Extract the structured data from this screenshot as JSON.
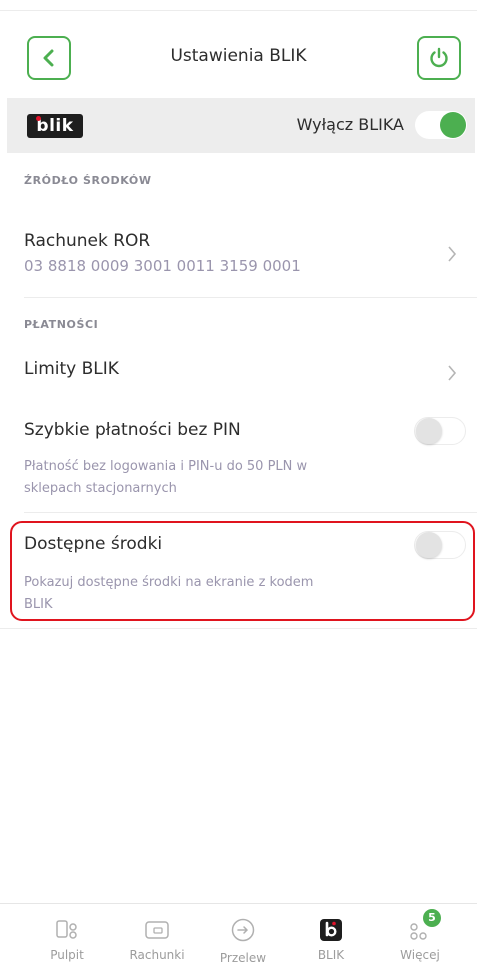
{
  "header": {
    "title": "Ustawienia BLIK",
    "back_icon": "chevron-left-icon",
    "power_icon": "power-icon"
  },
  "blik_bar": {
    "logo_text": "blik",
    "toggle_label": "Wyłącz BLIKA",
    "toggle_on": true
  },
  "funds_source": {
    "section_label": "ŹRÓDŁO ŚRODKÓW",
    "account_name": "Rachunek ROR",
    "account_number": "03 8818 0009 3001 0011 3159 0001"
  },
  "payments": {
    "section_label": "PŁATNOŚCI",
    "limits_label": "Limity BLIK",
    "quick_pay_label": "Szybkie płatności bez PIN",
    "quick_pay_desc": "Płatność bez logowania i PIN-u do 50 PLN w sklepach stacjonarnych",
    "quick_pay_on": false,
    "available_funds_label": "Dostępne środki",
    "available_funds_desc": "Pokazuj dostępne środki na ekranie z kodem BLIK",
    "available_funds_on": false
  },
  "bottom_nav": {
    "items": [
      {
        "label": "Pulpit",
        "icon": "dashboard-icon"
      },
      {
        "label": "Rachunki",
        "icon": "wallet-icon"
      },
      {
        "label": "Przelew",
        "icon": "transfer-icon"
      },
      {
        "label": "BLIK",
        "icon": "blik-icon"
      },
      {
        "label": "Więcej",
        "icon": "more-icon"
      }
    ],
    "more_badge": "5"
  },
  "colors": {
    "accent": "#4caf50",
    "highlight": "#e0141e",
    "muted_text": "#9a95ad"
  }
}
